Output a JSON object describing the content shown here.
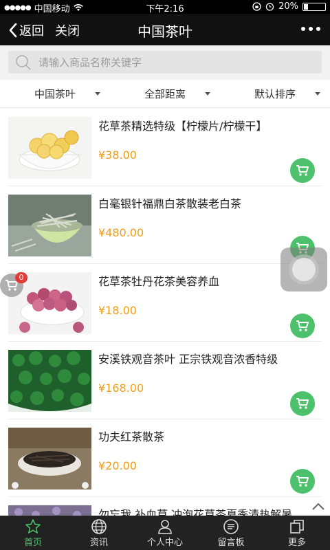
{
  "status_bar": {
    "carrier": "中国移动",
    "time": "下午2:16",
    "battery": "20%",
    "battery_level": 0.2
  },
  "nav": {
    "back_label": "返回",
    "close_label": "关闭",
    "title": "中国茶叶",
    "more_icon": "more-dots-icon"
  },
  "search": {
    "placeholder": "请输入商品名称关键字",
    "value": ""
  },
  "filters": [
    {
      "label": "中国茶叶"
    },
    {
      "label": "全部距离"
    },
    {
      "label": "默认排序"
    }
  ],
  "products": [
    {
      "name": "花草茶精选特级【柠檬片/柠檬干】",
      "price": "¥38.00",
      "image": "lemon-slices"
    },
    {
      "name": "白毫银针福鼎白茶散装老白茶",
      "price": "¥480.00",
      "image": "white-tea"
    },
    {
      "name": "花草茶牡丹花茶美容养血",
      "price": "¥18.00",
      "image": "peony-buds"
    },
    {
      "name": "安溪铁观音茶叶 正宗铁观音浓香特级",
      "price": "¥168.00",
      "image": "tieguanyin"
    },
    {
      "name": "功夫红茶散茶",
      "price": "¥20.00",
      "image": "black-tea"
    },
    {
      "name": "勿忘我 补血草 冲泡花草茶夏季清热解暑",
      "price": "",
      "image": "forget-me-not"
    }
  ],
  "cart": {
    "count": "0"
  },
  "tabs": [
    {
      "label": "首页",
      "icon": "star-icon"
    },
    {
      "label": "资讯",
      "icon": "globe-icon"
    },
    {
      "label": "个人中心",
      "icon": "user-icon"
    },
    {
      "label": "留言板",
      "icon": "message-icon"
    },
    {
      "label": "更多",
      "icon": "copy-icon"
    }
  ],
  "colors": {
    "accent_green": "#4cc06a",
    "price_orange": "#f39c12",
    "badge_red": "#e53935"
  }
}
